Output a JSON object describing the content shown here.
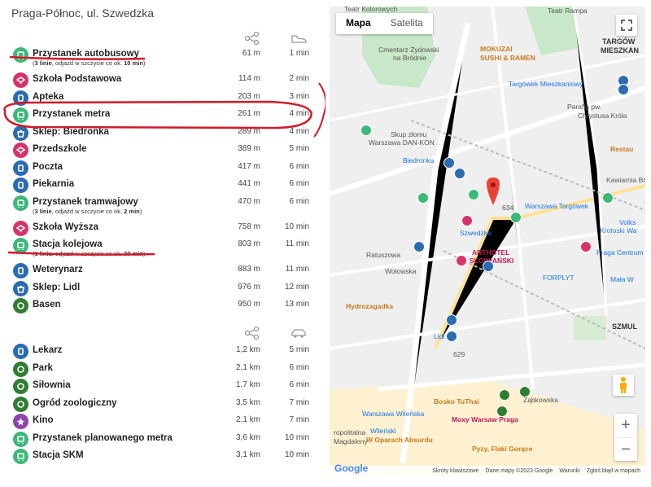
{
  "location": "Praga-Północ, ul. Szwedzka",
  "section1": {
    "items": [
      {
        "name": "Przystanek autobusowy",
        "sub_pre": "3 linie",
        "sub_mid": ", odjazd w szczycie co ok. ",
        "sub_bold": "10 min",
        "sub_post": ")",
        "dist": "61 m",
        "time": "1 min",
        "color": "#3cb878",
        "icon": "bus-icon"
      },
      {
        "name": "Szkoła Podstawowa",
        "dist": "114 m",
        "time": "2 min",
        "color": "#d6336c",
        "icon": "school-icon"
      },
      {
        "name": "Apteka",
        "dist": "203 m",
        "time": "3 min",
        "color": "#2b6cb0",
        "icon": "pharmacy-icon"
      },
      {
        "name": "Przystanek metra",
        "dist": "261 m",
        "time": "4 min",
        "color": "#3cb878",
        "icon": "metro-icon"
      },
      {
        "name": "Sklep: Biedronka",
        "dist": "289 m",
        "time": "4 min",
        "color": "#2b6cb0",
        "icon": "shop-icon"
      },
      {
        "name": "Przedszkole",
        "dist": "389 m",
        "time": "5 min",
        "color": "#d6336c",
        "icon": "kindergarten-icon"
      },
      {
        "name": "Poczta",
        "dist": "417 m",
        "time": "6 min",
        "color": "#2b6cb0",
        "icon": "post-icon"
      },
      {
        "name": "Piekarnia",
        "dist": "441 m",
        "time": "6 min",
        "color": "#2b6cb0",
        "icon": "bakery-icon"
      },
      {
        "name": "Przystanek tramwajowy",
        "sub_pre": "3 linie",
        "sub_mid": ", odjazd w szczycie co ok. ",
        "sub_bold": "2 min",
        "sub_post": ")",
        "dist": "470 m",
        "time": "6 min",
        "color": "#3cb878",
        "icon": "tram-icon"
      },
      {
        "name": "Szkoła Wyższa",
        "dist": "758 m",
        "time": "10 min",
        "color": "#d6336c",
        "icon": "university-icon"
      },
      {
        "name": "Stacja kolejowa",
        "sub_pre": "1 linia",
        "sub_mid": ", odjazd w szczycie co ok. ",
        "sub_bold": "30 min",
        "sub_post": ")",
        "dist": "803 m",
        "time": "11 min",
        "color": "#3cb878",
        "icon": "train-icon"
      },
      {
        "name": "Weterynarz",
        "dist": "883 m",
        "time": "11 min",
        "color": "#2b6cb0",
        "icon": "vet-icon"
      },
      {
        "name": "Sklep: Lidl",
        "dist": "976 m",
        "time": "12 min",
        "color": "#2b6cb0",
        "icon": "shop-icon"
      },
      {
        "name": "Basen",
        "dist": "950 m",
        "time": "13 min",
        "color": "#2e7d32",
        "icon": "pool-icon"
      }
    ]
  },
  "section2": {
    "items": [
      {
        "name": "Lekarz",
        "dist": "1,2 km",
        "time": "5 min",
        "color": "#2b6cb0",
        "icon": "doctor-icon"
      },
      {
        "name": "Park",
        "dist": "2,1 km",
        "time": "6 min",
        "color": "#2e7d32",
        "icon": "park-icon"
      },
      {
        "name": "Siłownia",
        "dist": "1,7 km",
        "time": "6 min",
        "color": "#2e7d32",
        "icon": "gym-icon"
      },
      {
        "name": "Ogród zoologiczny",
        "dist": "3,5 km",
        "time": "7 min",
        "color": "#2e7d32",
        "icon": "zoo-icon"
      },
      {
        "name": "Kino",
        "dist": "2,1 km",
        "time": "7 min",
        "color": "#8e44ad",
        "icon": "cinema-icon"
      },
      {
        "name": "Przystanek planowanego metra",
        "dist": "3,6 km",
        "time": "10 min",
        "color": "#3cb878",
        "icon": "metro-icon"
      },
      {
        "name": "Stacja SKM",
        "dist": "3,1 km",
        "time": "10 min",
        "color": "#3cb878",
        "icon": "train-icon"
      }
    ]
  },
  "map": {
    "type_options": [
      "Mapa",
      "Satelita"
    ],
    "zoom_in": "+",
    "zoom_out": "−",
    "footer": [
      "Skróty klawiszowe",
      "Dane mapy ©2023 Google",
      "Warunki",
      "Zgłoś błąd w mapach"
    ],
    "logo": "Google",
    "labels": [
      {
        "text": "Teatr Kolorowych",
        "cls": ""
      },
      {
        "text": "Teatr Rampa",
        "cls": ""
      },
      {
        "text": "TARGÓW",
        "cls": "bold"
      },
      {
        "text": "MIESZKAN",
        "cls": "bold"
      },
      {
        "text": "Cmentarz Żydowski",
        "cls": ""
      },
      {
        "text": "na Bródnie",
        "cls": ""
      },
      {
        "text": "MOKUZAI",
        "cls": "brown"
      },
      {
        "text": "SUSHI & RAMEN",
        "cls": "brown"
      },
      {
        "text": "Targówek Mieszkaniowy",
        "cls": "blue"
      },
      {
        "text": "Parafia pw.",
        "cls": ""
      },
      {
        "text": "Chrystusa Króla",
        "cls": ""
      },
      {
        "text": "Skup złomu",
        "cls": ""
      },
      {
        "text": "Warszawa DAN-KON",
        "cls": ""
      },
      {
        "text": "Restau",
        "cls": "brown"
      },
      {
        "text": "Biedronka",
        "cls": "blue"
      },
      {
        "text": "Warszawa Targówek",
        "cls": "blue"
      },
      {
        "text": "Szwedzka",
        "cls": "blue"
      },
      {
        "text": "ARTHOTEL",
        "cls": "pink"
      },
      {
        "text": "SLOWIAŃSKI",
        "cls": "pink"
      },
      {
        "text": "Krotoski Wa",
        "cls": "blue"
      },
      {
        "text": "Volks",
        "cls": "blue"
      },
      {
        "text": "Praga Centrum",
        "cls": "blue"
      },
      {
        "text": "FORPLYT",
        "cls": "blue"
      },
      {
        "text": "Mała W",
        "cls": "blue"
      },
      {
        "text": "Hydrozagadka",
        "cls": "brown"
      },
      {
        "text": "SZMUL",
        "cls": "bold"
      },
      {
        "text": "Lidl",
        "cls": "blue"
      },
      {
        "text": "Warszawa Wileńska",
        "cls": "blue"
      },
      {
        "text": "Bosko TuThai",
        "cls": "brown"
      },
      {
        "text": "Moxy Warsaw Praga",
        "cls": "pink"
      },
      {
        "text": "Ząbkowska",
        "cls": ""
      },
      {
        "text": "Wileński",
        "cls": "blue"
      },
      {
        "text": "W Oparach Absurdu",
        "cls": "brown"
      },
      {
        "text": "Pyzy, Flaki Gorące",
        "cls": "brown"
      },
      {
        "text": "ropolitalna",
        "cls": ""
      },
      {
        "text": "Magdaleny",
        "cls": ""
      },
      {
        "text": "Kawiarnia Brand",
        "cls": ""
      },
      {
        "text": "Ratuszowa",
        "cls": ""
      },
      {
        "text": "Wołowska",
        "cls": ""
      },
      {
        "text": "634",
        "cls": ""
      },
      {
        "text": "629",
        "cls": ""
      }
    ]
  }
}
